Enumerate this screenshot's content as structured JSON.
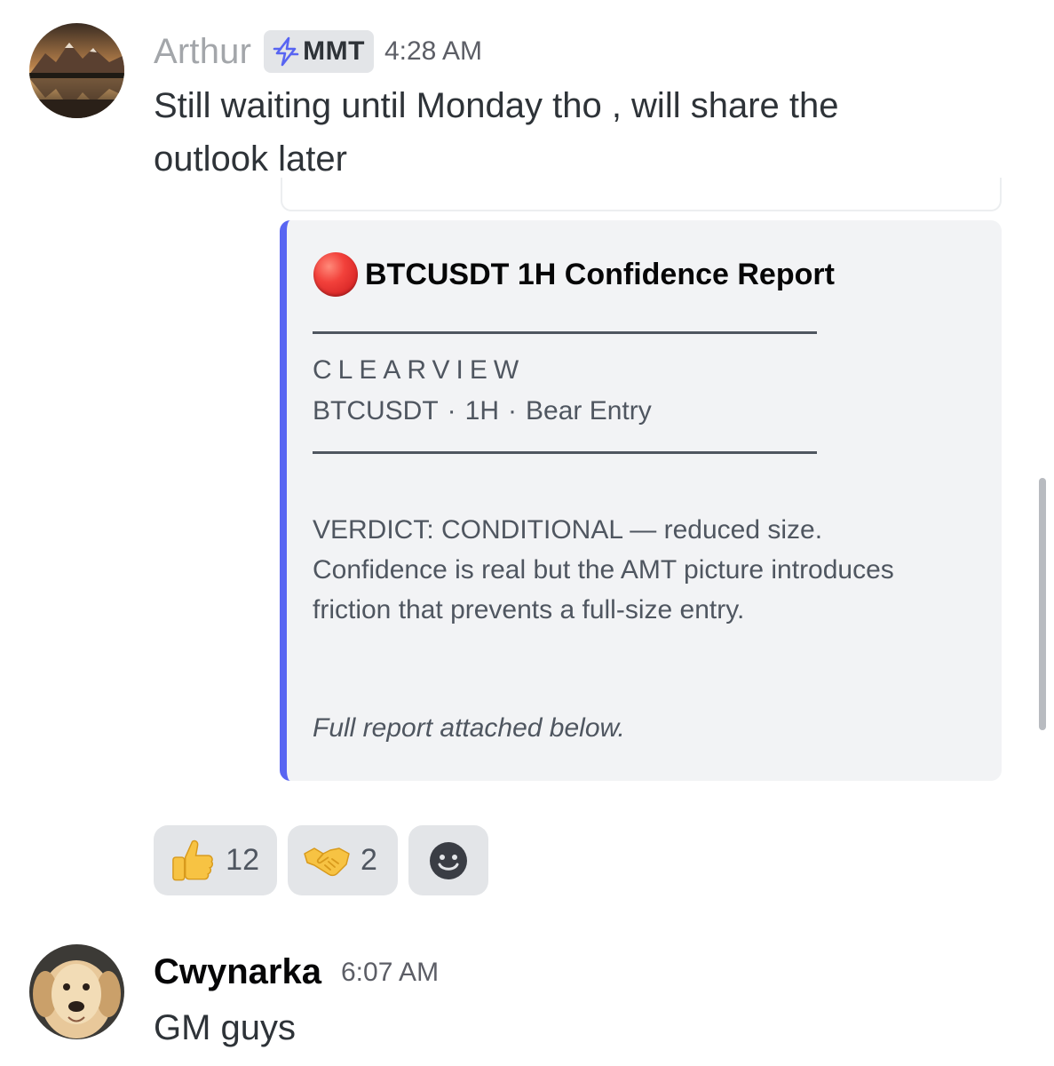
{
  "messages": [
    {
      "author": "Arthur",
      "badge": "MMT",
      "time": "4:28 AM",
      "text_lines": [
        "Still waiting until Monday tho , will share the",
        "outlook later"
      ]
    },
    {
      "author": "Cwynarka",
      "time": "6:07 AM",
      "text": "GM guys"
    }
  ],
  "embed": {
    "accent_color": "#5865f2",
    "title_icon": "red-circle-icon",
    "title": "BTCUSDT 1H Confidence Report",
    "brand": "CLEARVIEW",
    "meta": {
      "symbol": "BTCUSDT",
      "sep": "·",
      "timeframe": "1H",
      "signal": "Bear Entry"
    },
    "verdict_lines": [
      "VERDICT: CONDITIONAL — reduced size.",
      "Confidence is real but the AMT picture introduces",
      "friction that prevents a full-size entry."
    ],
    "footer": "Full report attached below."
  },
  "reactions": [
    {
      "icon": "thumbs-up-icon",
      "count": "12"
    },
    {
      "icon": "handshake-icon",
      "count": "2"
    }
  ],
  "add_reaction_icon": "smiley-add-icon"
}
